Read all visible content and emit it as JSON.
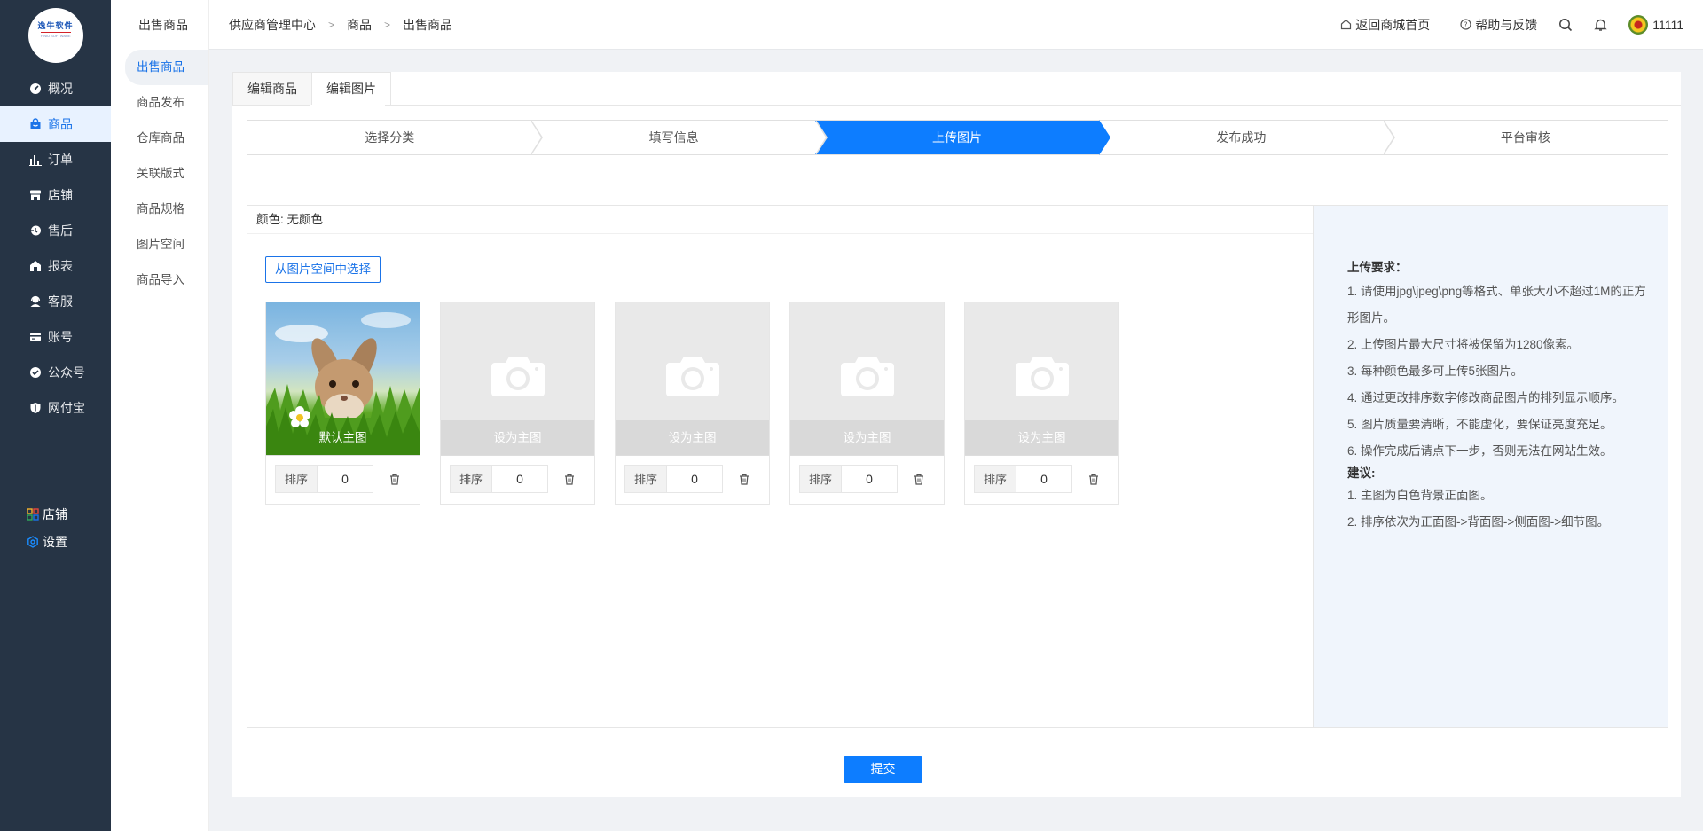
{
  "logo": {
    "text": "逸牛软件",
    "sub": "YINIU SOFTWARE"
  },
  "nav": {
    "items": [
      {
        "label": "概况",
        "icon": "gauge-icon"
      },
      {
        "label": "商品",
        "icon": "bag-icon",
        "active": true
      },
      {
        "label": "订单",
        "icon": "bar-chart-icon"
      },
      {
        "label": "店铺",
        "icon": "store-icon"
      },
      {
        "label": "售后",
        "icon": "service-icon"
      },
      {
        "label": "报表",
        "icon": "house-icon"
      },
      {
        "label": "客服",
        "icon": "headset-icon"
      },
      {
        "label": "账号",
        "icon": "card-icon"
      },
      {
        "label": "公众号",
        "icon": "badge-check-icon"
      },
      {
        "label": "网付宝",
        "icon": "shield-icon"
      }
    ],
    "bottom": [
      {
        "label": "店铺",
        "icon": "grid-icon"
      },
      {
        "label": "设置",
        "icon": "settings-icon"
      }
    ]
  },
  "subnav": {
    "title": "出售商品",
    "items": [
      {
        "label": "出售商品",
        "active": true
      },
      {
        "label": "商品发布"
      },
      {
        "label": "仓库商品"
      },
      {
        "label": "关联版式"
      },
      {
        "label": "商品规格"
      },
      {
        "label": "图片空间"
      },
      {
        "label": "商品导入"
      }
    ]
  },
  "header": {
    "breadcrumb": [
      "供应商管理中心",
      "商品",
      "出售商品"
    ],
    "home_link": "返回商城首页",
    "help_link": "帮助与反馈",
    "user": "11111"
  },
  "tabs": [
    {
      "label": "编辑商品"
    },
    {
      "label": "编辑图片",
      "active": true
    }
  ],
  "steps": [
    {
      "label": "选择分类"
    },
    {
      "label": "填写信息"
    },
    {
      "label": "上传图片",
      "active": true
    },
    {
      "label": "发布成功"
    },
    {
      "label": "平台审核"
    }
  ],
  "panel": {
    "color_label": "颜色:",
    "color_value": "无颜色",
    "pick_button": "从图片空间中选择",
    "sort_label": "排序",
    "slots": [
      {
        "caption": "默认主图",
        "sort": "0",
        "filled": true
      },
      {
        "caption": "设为主图",
        "sort": "0",
        "filled": false
      },
      {
        "caption": "设为主图",
        "sort": "0",
        "filled": false
      },
      {
        "caption": "设为主图",
        "sort": "0",
        "filled": false
      },
      {
        "caption": "设为主图",
        "sort": "0",
        "filled": false
      }
    ],
    "requirements_title": "上传要求：",
    "requirements": [
      "1. 请使用jpg\\jpeg\\png等格式、单张大小不超过1M的正方形图片。",
      "2. 上传图片最大尺寸将被保留为1280像素。",
      "3. 每种颜色最多可上传5张图片。",
      "4. 通过更改排序数字修改商品图片的排列显示顺序。",
      "5. 图片质量要清晰，不能虚化，要保证亮度充足。",
      "6. 操作完成后请点下一步，否则无法在网站生效。"
    ],
    "advice_title": "建议:",
    "advice": [
      "1. 主图为白色背景正面图。",
      "2. 排序依次为正面图->背面图->侧面图->细节图。"
    ]
  },
  "submit_label": "提交",
  "colors": {
    "primary": "#0d7dff",
    "sidebar": "#263445",
    "panel_right_bg": "#f0f5fc"
  }
}
